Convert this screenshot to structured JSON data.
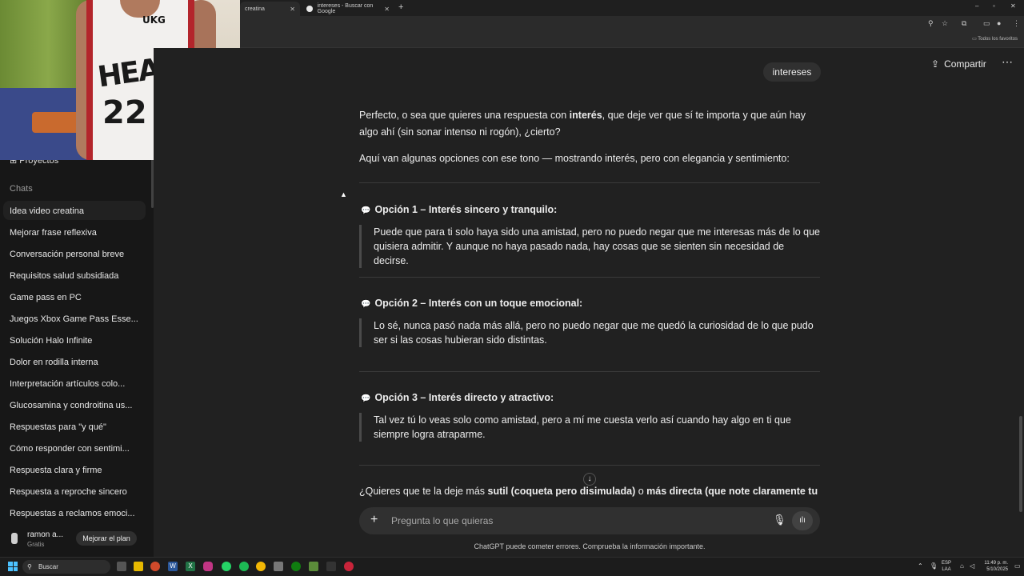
{
  "browser": {
    "tabs": [
      {
        "label": "creatina",
        "active": true
      },
      {
        "label": "intereses - Buscar con Google",
        "active": false
      }
    ],
    "new_tab": "+",
    "bookmarks_all": "Todos los favoritos",
    "window_controls": [
      "–",
      "▫",
      "✕"
    ]
  },
  "sidebar": {
    "projects_label": "Proyectos",
    "chats_heading": "Chats",
    "chats": [
      "Idea video creatina",
      "Mejorar frase reflexiva",
      "Conversación personal breve",
      "Requisitos salud subsidiada",
      "Game pass en PC",
      "Juegos Xbox Game Pass Esse...",
      "Solución Halo Infinite",
      "Dolor en rodilla interna",
      "Interpretación artículos colo...",
      "Glucosamina y condroitina us...",
      "Respuestas para \"y qué\"",
      "Cómo responder con sentimi...",
      "Respuesta clara y firme",
      "Respuesta a reproche sincero",
      "Respuestas a reclamos emoci..."
    ],
    "user": {
      "name": "ramon a...",
      "plan": "Gratis",
      "upgrade_label": "Mejorar el plan"
    }
  },
  "webcam": {
    "brand": "UKG",
    "team": "HEAT",
    "number": "22"
  },
  "header": {
    "share_label": "Compartir",
    "more_label": "⋯"
  },
  "conversation": {
    "user_message": "intereses",
    "intro_1": "Perfecto, o sea que quieres una respuesta con interés, que deje ver que sí te importa y que aún hay algo ahí (sin sonar intenso ni rogón), ¿cierto?",
    "intro_2": "Aquí van algunas opciones con ese tono — mostrando interés, pero con elegancia y sentimiento:",
    "options": [
      {
        "title": "Opción 1 – Interés sincero y tranquilo:",
        "text": "Puede que para ti solo haya sido una amistad, pero no puedo negar que me interesas más de lo que quisiera admitir. Y aunque no haya pasado nada, hay cosas que se sienten sin necesidad de decirse."
      },
      {
        "title": "Opción 2 – Interés con un toque emocional:",
        "text": "Lo sé, nunca pasó nada más allá, pero no puedo negar que me quedó la curiosidad de lo que pudo ser si las cosas hubieran sido distintas."
      },
      {
        "title": "Opción 3 – Interés directo y atractivo:",
        "text": "Tal vez tú lo veas solo como amistad, pero a mí me cuesta verlo así cuando hay algo en ti que siempre logra atraparme."
      }
    ],
    "closing": "¿Quieres que te la deje más sutil (coqueta pero disimulada) o más directa (que note claramente tu in"
  },
  "composer": {
    "placeholder": "Pregunta lo que quieras",
    "plus": "+"
  },
  "disclaimer": "ChatGPT puede cometer errores. Comprueba la información importante.",
  "taskbar": {
    "search_label": "Buscar",
    "lang": "ESP\nLAA",
    "time": "11:49 p. m.",
    "date": "5/10/2025"
  }
}
